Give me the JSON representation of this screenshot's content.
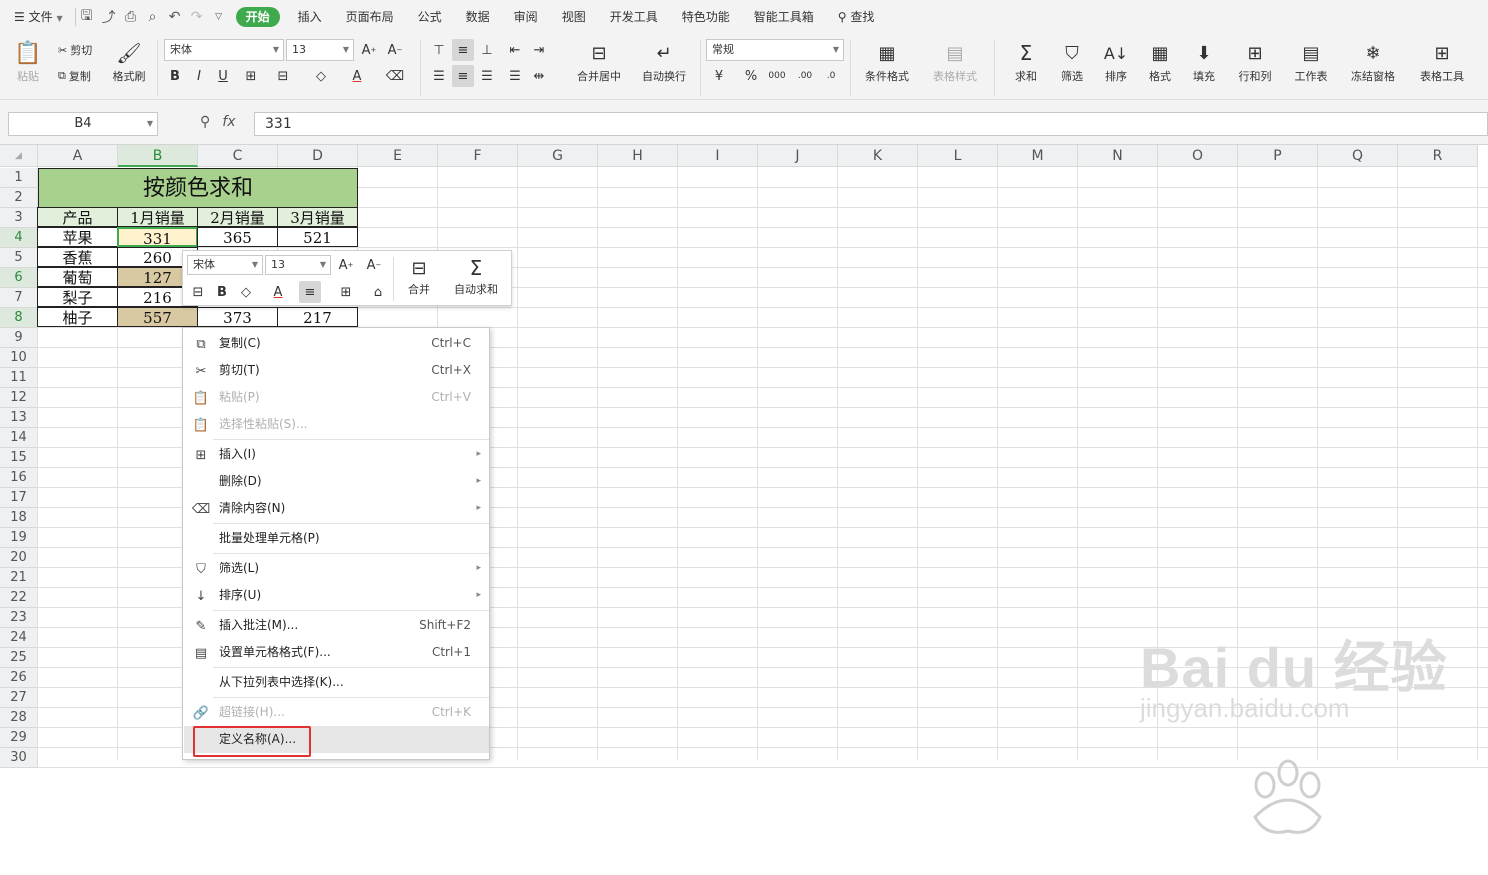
{
  "menubar": {
    "file": "文件",
    "tabs": [
      "开始",
      "插入",
      "页面布局",
      "公式",
      "数据",
      "审阅",
      "视图",
      "开发工具",
      "特色功能",
      "智能工具箱"
    ],
    "search": "查找"
  },
  "ribbon": {
    "paste": "粘贴",
    "cut": "剪切",
    "copy": "复制",
    "format_painter": "格式刷",
    "font_name": "宋体",
    "font_size": "13",
    "merge_center": "合并居中",
    "auto_wrap": "自动换行",
    "number_format": "常规",
    "conditional_format": "条件格式",
    "table_style": "表格样式",
    "sum": "求和",
    "filter": "筛选",
    "sort": "排序",
    "format": "格式",
    "fill": "填充",
    "rows_cols": "行和列",
    "worksheet": "工作表",
    "freeze": "冻结窗格",
    "table_tools": "表格工具"
  },
  "formula_bar": {
    "name_box": "B4",
    "fx": "fx",
    "value": "331"
  },
  "sheet": {
    "columns": [
      "A",
      "B",
      "C",
      "D",
      "E",
      "F",
      "G",
      "H",
      "I",
      "J",
      "K",
      "L",
      "M",
      "N",
      "O",
      "P",
      "Q",
      "R"
    ],
    "rows": [
      "1",
      "2",
      "3",
      "4",
      "5",
      "6",
      "7",
      "8",
      "9",
      "10",
      "11",
      "12",
      "13",
      "14",
      "15",
      "16",
      "17",
      "18",
      "19",
      "20",
      "21",
      "22",
      "23",
      "24",
      "25",
      "26",
      "27",
      "28",
      "29",
      "30"
    ],
    "title": "按颜色求和",
    "header": [
      "产品",
      "1月销量",
      "2月销量",
      "3月销量"
    ],
    "data": [
      [
        "苹果",
        "331",
        "365",
        "521"
      ],
      [
        "香蕉",
        "260",
        "",
        ""
      ],
      [
        "葡萄",
        "127",
        "",
        ""
      ],
      [
        "梨子",
        "216",
        "",
        ""
      ],
      [
        "柚子",
        "557",
        "373",
        "217"
      ]
    ]
  },
  "mini_toolbar": {
    "font_name": "宋体",
    "font_size": "13",
    "merge": "合并",
    "autosum": "自动求和"
  },
  "context_menu": [
    {
      "label": "复制(C)",
      "shortcut": "Ctrl+C",
      "icon": "copy-icon",
      "disabled": false
    },
    {
      "label": "剪切(T)",
      "shortcut": "Ctrl+X",
      "icon": "scissors-icon",
      "disabled": false
    },
    {
      "label": "粘贴(P)",
      "shortcut": "Ctrl+V",
      "icon": "paste-icon",
      "disabled": true
    },
    {
      "label": "选择性粘贴(S)...",
      "shortcut": "",
      "icon": "paste-special-icon",
      "disabled": true
    },
    {
      "label": "插入(I)",
      "shortcut": "",
      "icon": "insert-icon",
      "disabled": false
    },
    {
      "label": "删除(D)",
      "shortcut": "",
      "icon": "",
      "disabled": false
    },
    {
      "label": "清除内容(N)",
      "shortcut": "",
      "icon": "eraser-icon",
      "disabled": false
    },
    {
      "label": "批量处理单元格(P)",
      "shortcut": "",
      "icon": "",
      "disabled": false
    },
    {
      "label": "筛选(L)",
      "shortcut": "",
      "icon": "filter-icon",
      "disabled": false
    },
    {
      "label": "排序(U)",
      "shortcut": "",
      "icon": "sort-icon",
      "disabled": false
    },
    {
      "label": "插入批注(M)...",
      "shortcut": "Shift+F2",
      "icon": "comment-icon",
      "disabled": false
    },
    {
      "label": "设置单元格格式(F)...",
      "shortcut": "Ctrl+1",
      "icon": "format-cells-icon",
      "disabled": false
    },
    {
      "label": "从下拉列表中选择(K)...",
      "shortcut": "",
      "icon": "",
      "disabled": false
    },
    {
      "label": "超链接(H)...",
      "shortcut": "Ctrl+K",
      "icon": "link-icon",
      "disabled": true
    },
    {
      "label": "定义名称(A)...",
      "shortcut": "",
      "icon": "",
      "disabled": false
    }
  ],
  "watermark": {
    "brand": "Bai du 经验",
    "url": "jingyan.baidu.com"
  },
  "colors": {
    "accent": "#3fa94d",
    "title_fill": "#a9d18e",
    "highlight_red": "#e03030"
  }
}
